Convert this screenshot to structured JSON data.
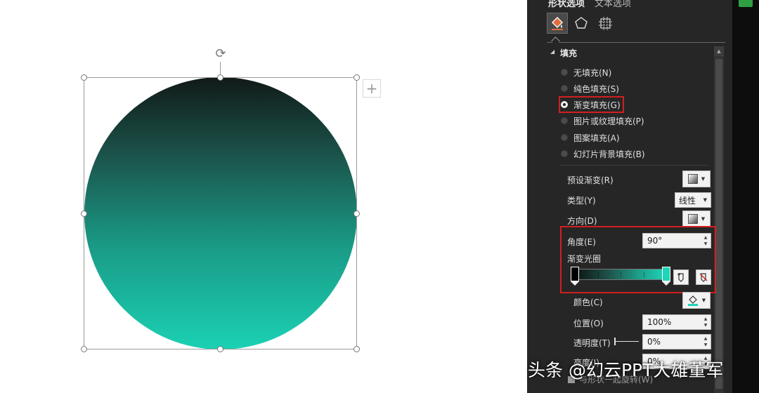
{
  "format_pane": {
    "tabs": [
      "形状选项",
      "文本选项"
    ],
    "categories": [
      "fill-line",
      "effects",
      "size-properties"
    ],
    "fill_section": {
      "header": "填充",
      "options": [
        {
          "label": "无填充(N)",
          "checked": false
        },
        {
          "label": "纯色填充(S)",
          "checked": false
        },
        {
          "label": "渐变填充(G)",
          "checked": true
        },
        {
          "label": "图片或纹理填充(P)",
          "checked": false
        },
        {
          "label": "图案填充(A)",
          "checked": false
        },
        {
          "label": "幻灯片背景填充(B)",
          "checked": false
        }
      ]
    },
    "gradient": {
      "preset_label": "预设渐变(R)",
      "type_label": "类型(Y)",
      "type_value": "线性",
      "direction_label": "方向(D)",
      "angle_label": "角度(E)",
      "angle_value": "90°",
      "stops_label": "渐变光圈",
      "stops": [
        {
          "color": "#000000",
          "position_pct": 0
        },
        {
          "color": "#1fd4b7",
          "position_pct": 100
        }
      ],
      "color_label": "颜色(C)",
      "position_label": "位置(O)",
      "position_value": "100%",
      "transparency_label": "透明度(T)",
      "transparency_value": "0%",
      "brightness_label": "亮度(I)",
      "brightness_value": "0%",
      "rotate_with_shape_label": "与形状一起旋转(W)"
    }
  },
  "shape": {
    "type": "circle",
    "gradient_colors": [
      "#111a18",
      "#1bd1b3"
    ]
  },
  "watermark": {
    "text": "头条 @幻云PPT大雄董军"
  }
}
